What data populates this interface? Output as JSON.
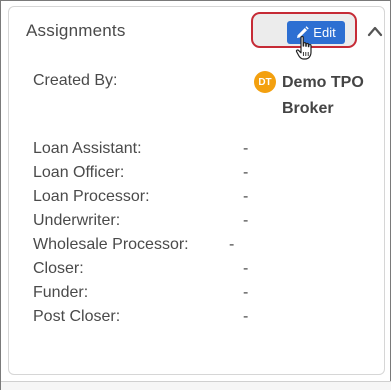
{
  "panel": {
    "title": "Assignments",
    "edit_label": "Edit"
  },
  "created_by": {
    "label": "Created By:",
    "avatar_initials": "DT",
    "name": "Demo TPO Broker"
  },
  "roles": [
    {
      "label": "Loan Assistant:",
      "value": "-"
    },
    {
      "label": "Loan Officer:",
      "value": "-"
    },
    {
      "label": "Loan Processor:",
      "value": "-"
    },
    {
      "label": "Underwriter:",
      "value": "-"
    },
    {
      "label": "Wholesale Processor:",
      "value": "-"
    },
    {
      "label": "Closer:",
      "value": "-"
    },
    {
      "label": "Funder:",
      "value": "-"
    },
    {
      "label": "Post Closer:",
      "value": "-"
    }
  ],
  "colors": {
    "edit_button": "#2d6fd2",
    "highlight_border": "#c62b36",
    "avatar": "#f3a00f"
  },
  "icons": [
    "pencil-icon",
    "hand-pointer-icon",
    "chevron-up-icon"
  ]
}
